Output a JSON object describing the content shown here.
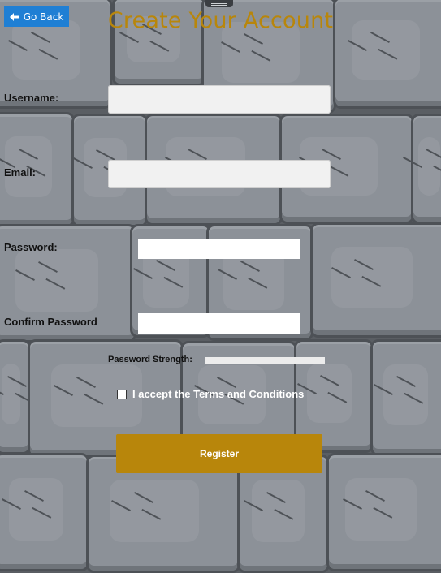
{
  "header": {
    "back_label": "Go Back",
    "back_icon": "arrow-left-icon",
    "title": "Create Your Account",
    "title_color": "#B8860B"
  },
  "form": {
    "username_label": "Username:",
    "username_value": "",
    "email_label": "Email:",
    "email_value": "",
    "password_label": "Password:",
    "password_value": "",
    "confirm_label": "Confirm Password",
    "confirm_value": "",
    "strength_label": "Password Strength:",
    "strength_value": 0,
    "terms_label": "I accept the Terms and Conditions",
    "terms_checked": false,
    "register_label": "Register"
  },
  "colors": {
    "accent": "#B8860B",
    "back_button": "#1F7FD4"
  }
}
